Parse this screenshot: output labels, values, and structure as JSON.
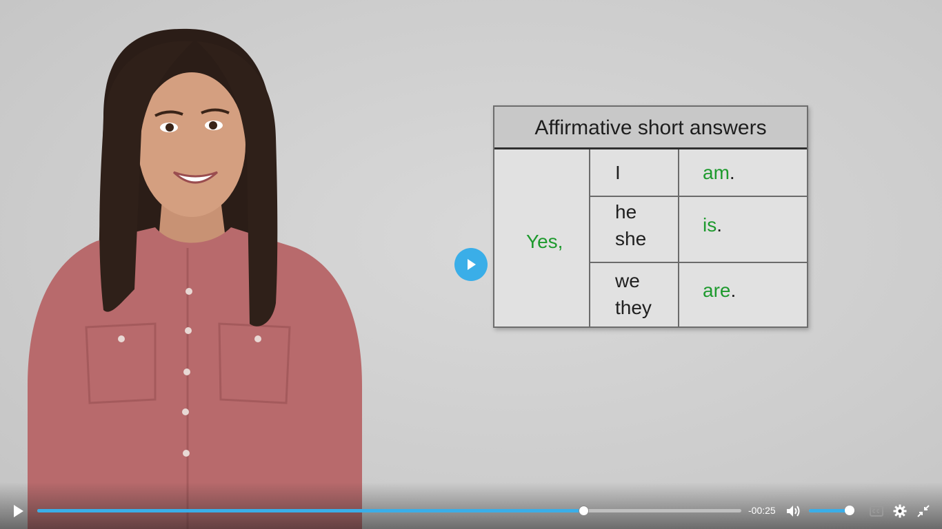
{
  "slide": {
    "table_title": "Affirmative short answers",
    "yes": "Yes,",
    "rows": [
      {
        "subject_line1": "I",
        "subject_line2": "",
        "verb": "am",
        "period": "."
      },
      {
        "subject_line1": "he",
        "subject_line2": "she",
        "verb": "is",
        "period": "."
      },
      {
        "subject_line1": "we",
        "subject_line2": "they",
        "verb": "are",
        "period": "."
      }
    ]
  },
  "player": {
    "time_remaining": "-00:25",
    "progress_fraction": 0.776,
    "volume_fraction": 0.9,
    "accent_color": "#3aaee8",
    "icons": [
      "play-icon",
      "volume-icon",
      "captions-icon",
      "settings-icon",
      "exit-fullscreen-icon"
    ]
  }
}
